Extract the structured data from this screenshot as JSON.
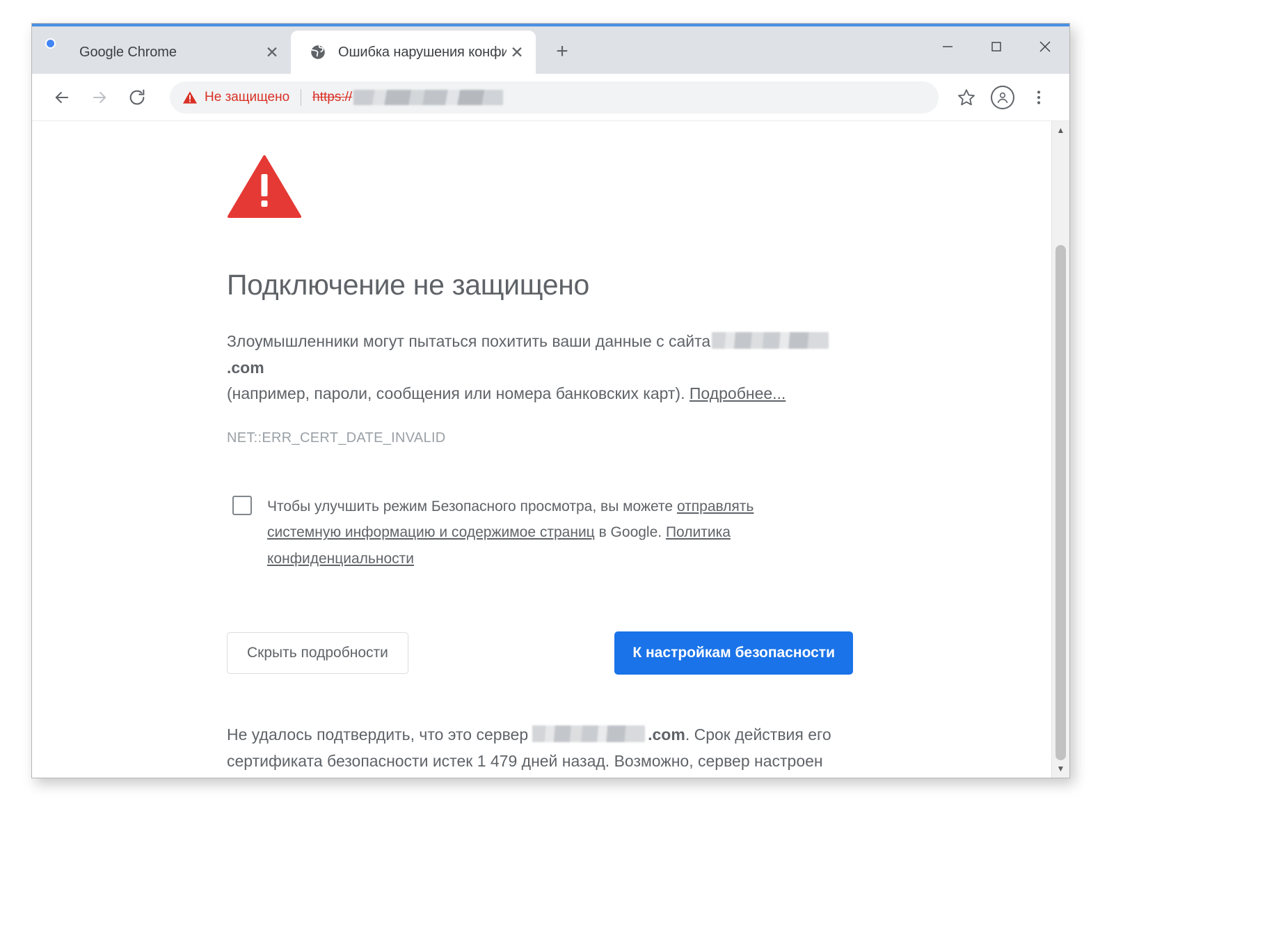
{
  "window": {
    "controls": {
      "minimize_label": "─",
      "maximize_label": "□",
      "close_label": "✕"
    }
  },
  "tabs": [
    {
      "title": "Google Chrome",
      "favicon": "chrome-logo-icon",
      "close_label": "✕",
      "active": false
    },
    {
      "title": "Ошибка нарушения конфиденц",
      "favicon": "globe-icon",
      "close_label": "✕",
      "active": true
    }
  ],
  "new_tab_label": "+",
  "toolbar": {
    "back_label": "←",
    "forward_label": "→",
    "reload_label": "↻",
    "omnibox": {
      "security_status": "Не защищено",
      "scheme": "https://",
      "host_redacted": true
    },
    "bookmark_label": "☆",
    "profile_label": "",
    "menu_label": "⋮"
  },
  "page": {
    "title": "Подключение не защищено",
    "body_prefix": "Злоумышленники могут пытаться похитить ваши данные с сайта",
    "body_host_tld": ".com",
    "body_suffix": "(например, пароли, сообщения или номера банковских карт).",
    "learn_more": "Подробнее...",
    "error_code": "NET::ERR_CERT_DATE_INVALID",
    "optin": {
      "text_before_link": "Чтобы улучшить режим Безопасного просмотра, вы можете",
      "link1": "отправлять системную информацию и содержимое страниц",
      "text_middle": "в Google.",
      "link2": "Политика конфиденциальности",
      "checked": false
    },
    "buttons": {
      "hide_details": "Скрыть подробности",
      "security_settings": "К настройкам безопасности"
    },
    "details": {
      "part1": "Не удалось подтвердить, что это сервер",
      "host_tld": ".com",
      "part2": ". Срок действия его сертификата безопасности истек 1 479 дней назад. Возможно, сервер настроен неправильно или кто-то пытается перехватить ваши данные. Обратите внимание, что на компьютере установлено время вторник, 30 апреля 2019 г.. Если оно неправильное, измените его и обновите страницу."
    }
  },
  "scrollbar": {
    "up_label": "▲",
    "down_label": "▼"
  },
  "colors": {
    "primary_button": "#1a73e8",
    "danger": "#d93025",
    "tab_strip": "#dee1e6",
    "text": "#5f6368",
    "green_highlight": "#a8c6a0"
  }
}
